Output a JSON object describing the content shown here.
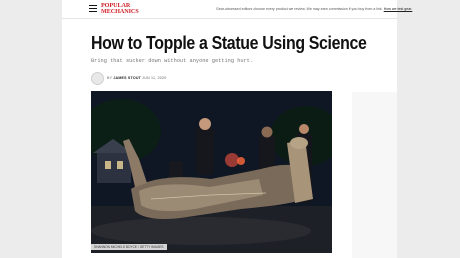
{
  "header": {
    "logo_line1": "POPULAR",
    "logo_line2": "MECHANICS",
    "disclaimer_text": "Gear-obsessed editors choose every product we review. We may earn commission if you buy from a link.",
    "disclaimer_link": "How we test gear."
  },
  "article": {
    "headline": "How to Topple a Statue Using Science",
    "dek": "Bring that sucker down without anyone getting hurt.",
    "byline_prefix": "BY",
    "author": "JAMES STOUT",
    "date": "JUN 11, 2020",
    "photo_credit": "SHANNON MICHELS BOYCE / GETTY IMAGES"
  },
  "colors": {
    "brand_red": "#cf1f27",
    "page_bg": "#ececec"
  },
  "icons": {
    "menu": "hamburger-menu-icon"
  }
}
